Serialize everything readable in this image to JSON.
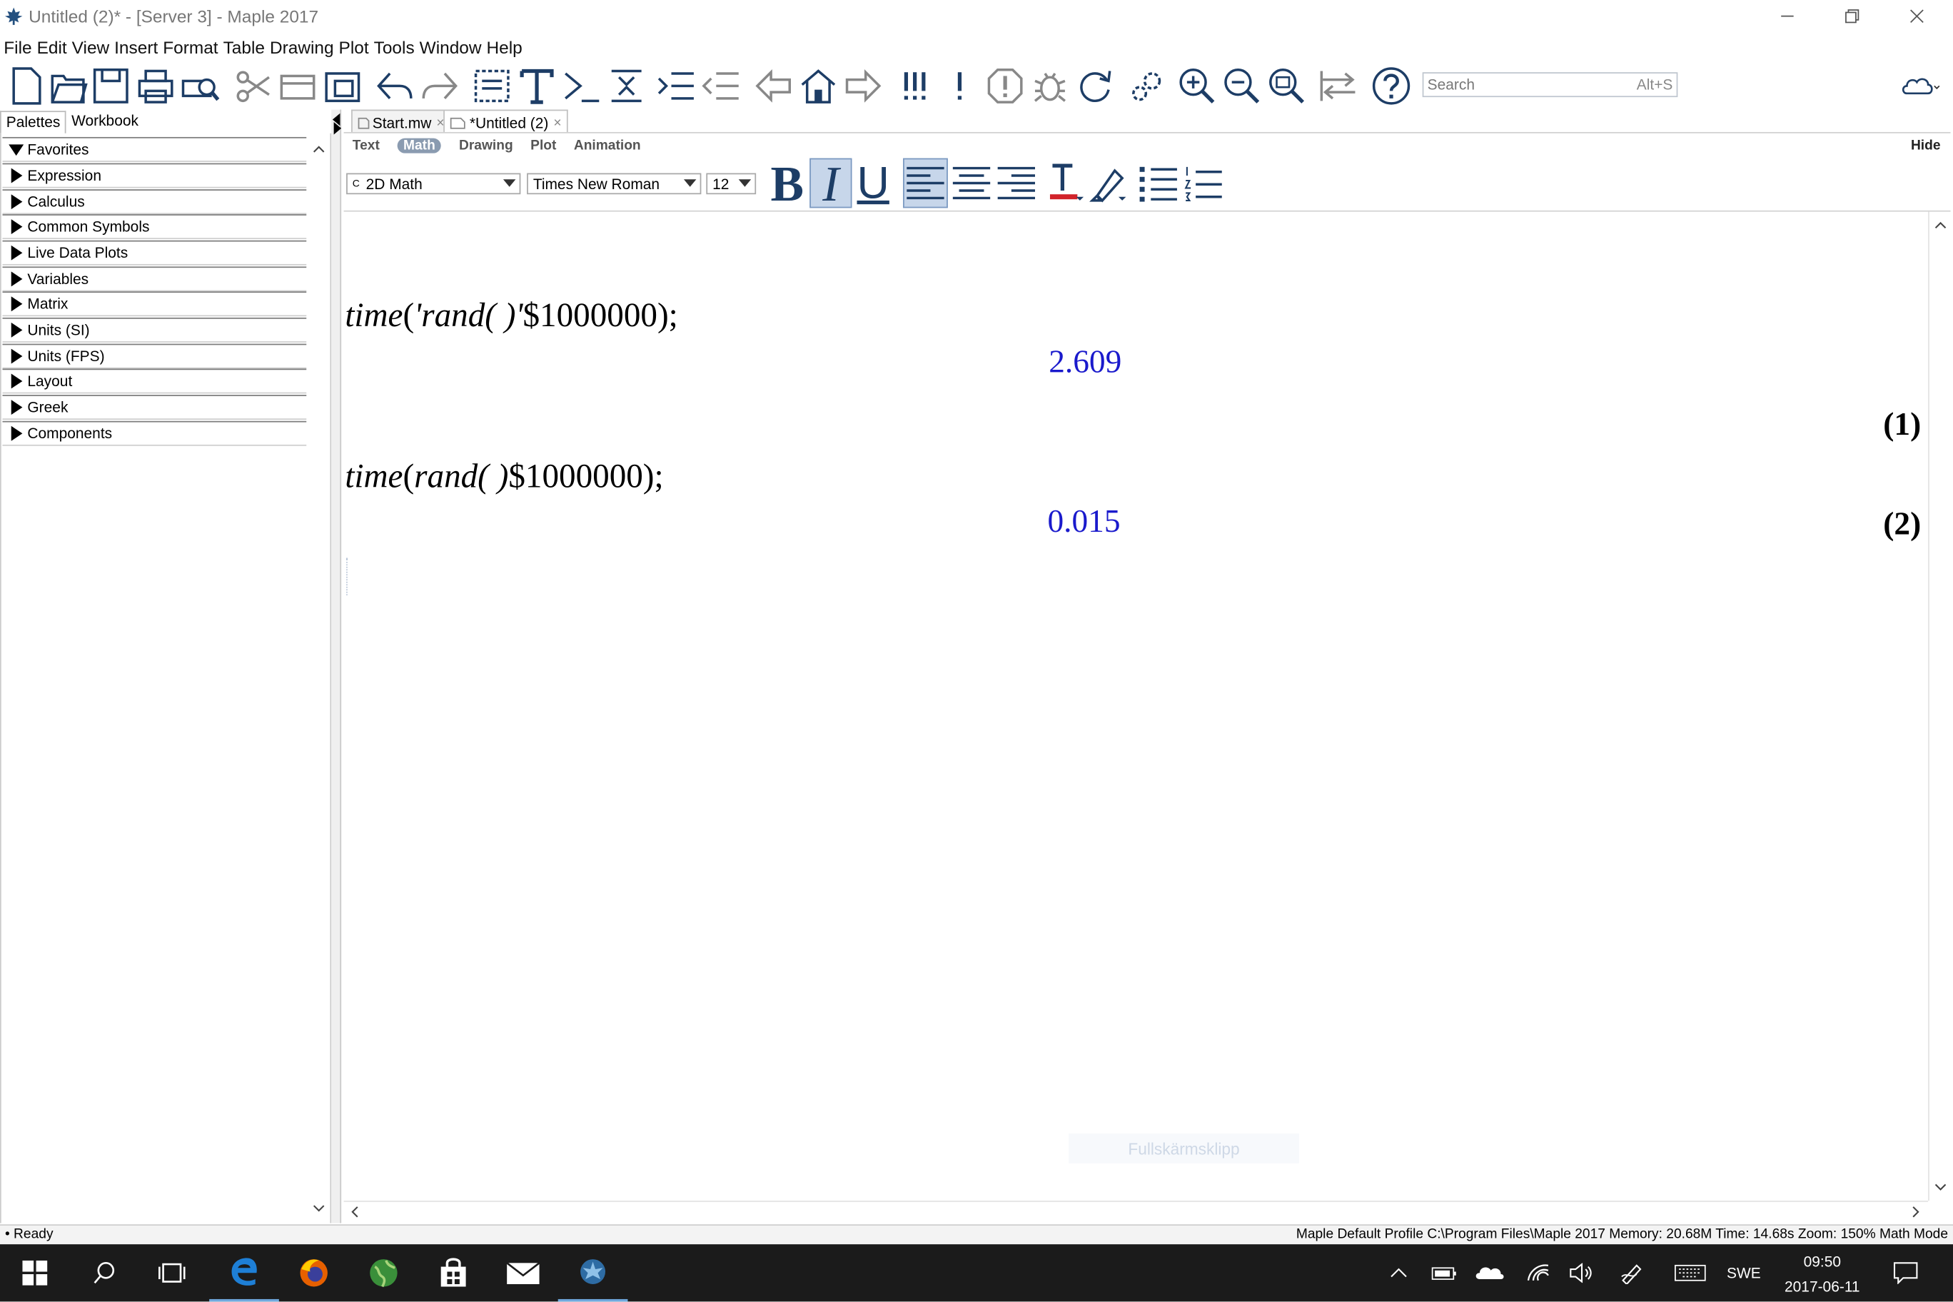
{
  "window": {
    "title": "Untitled (2)* - [Server 3] - Maple 2017"
  },
  "menu": [
    "File",
    "Edit",
    "View",
    "Insert",
    "Format",
    "Table",
    "Drawing",
    "Plot",
    "Tools",
    "Window",
    "Help"
  ],
  "search": {
    "placeholder": "Search",
    "shortcut": "Alt+S"
  },
  "left_panel": {
    "tabs": [
      "Palettes",
      "Workbook"
    ],
    "palettes": [
      "Favorites",
      "Expression",
      "Calculus",
      "Common Symbols",
      "Live Data Plots",
      "Variables",
      "Matrix",
      "Units (SI)",
      "Units (FPS)",
      "Layout",
      "Greek",
      "Components"
    ]
  },
  "doc_tabs": [
    {
      "label": "Start.mw"
    },
    {
      "label": "*Untitled (2)"
    }
  ],
  "context_bar": {
    "tabs": [
      "Text",
      "Math",
      "Drawing",
      "Plot",
      "Animation"
    ],
    "active_tab": "Math",
    "hide_label": "Hide",
    "mode_value": "2D Math",
    "mode_prefix": "C",
    "font_value": "Times New Roman",
    "size_value": "12",
    "bold": "B",
    "italic": "I",
    "underline": "U"
  },
  "document": {
    "inputs": [
      {
        "line": "time('rand( )'$1000000);",
        "parts": [
          "time",
          "(",
          "'rand( )'",
          "$1000000",
          ");"
        ]
      },
      {
        "line": "time(rand( )$1000000);",
        "parts": [
          "time",
          "(",
          "rand( )",
          "$1000000",
          ");"
        ]
      }
    ],
    "outputs": [
      {
        "value": "2.609",
        "label": "(1)"
      },
      {
        "value": "0.015",
        "label": "(2)"
      }
    ]
  },
  "overlay_toast": "Fullskärmsklipp",
  "status": {
    "left": "Ready",
    "right": "Maple Default Profile C:\\Program Files\\Maple 2017 Memory: 20.68M Time: 14.68s Zoom: 150% Math Mode"
  },
  "taskbar": {
    "language": "SWE",
    "time": "09:50",
    "date": "2017-06-11"
  },
  "colors": {
    "output_blue": "#1a1acc",
    "icon_blue": "#1d3d66",
    "taskbar": "#1b1b1b"
  }
}
